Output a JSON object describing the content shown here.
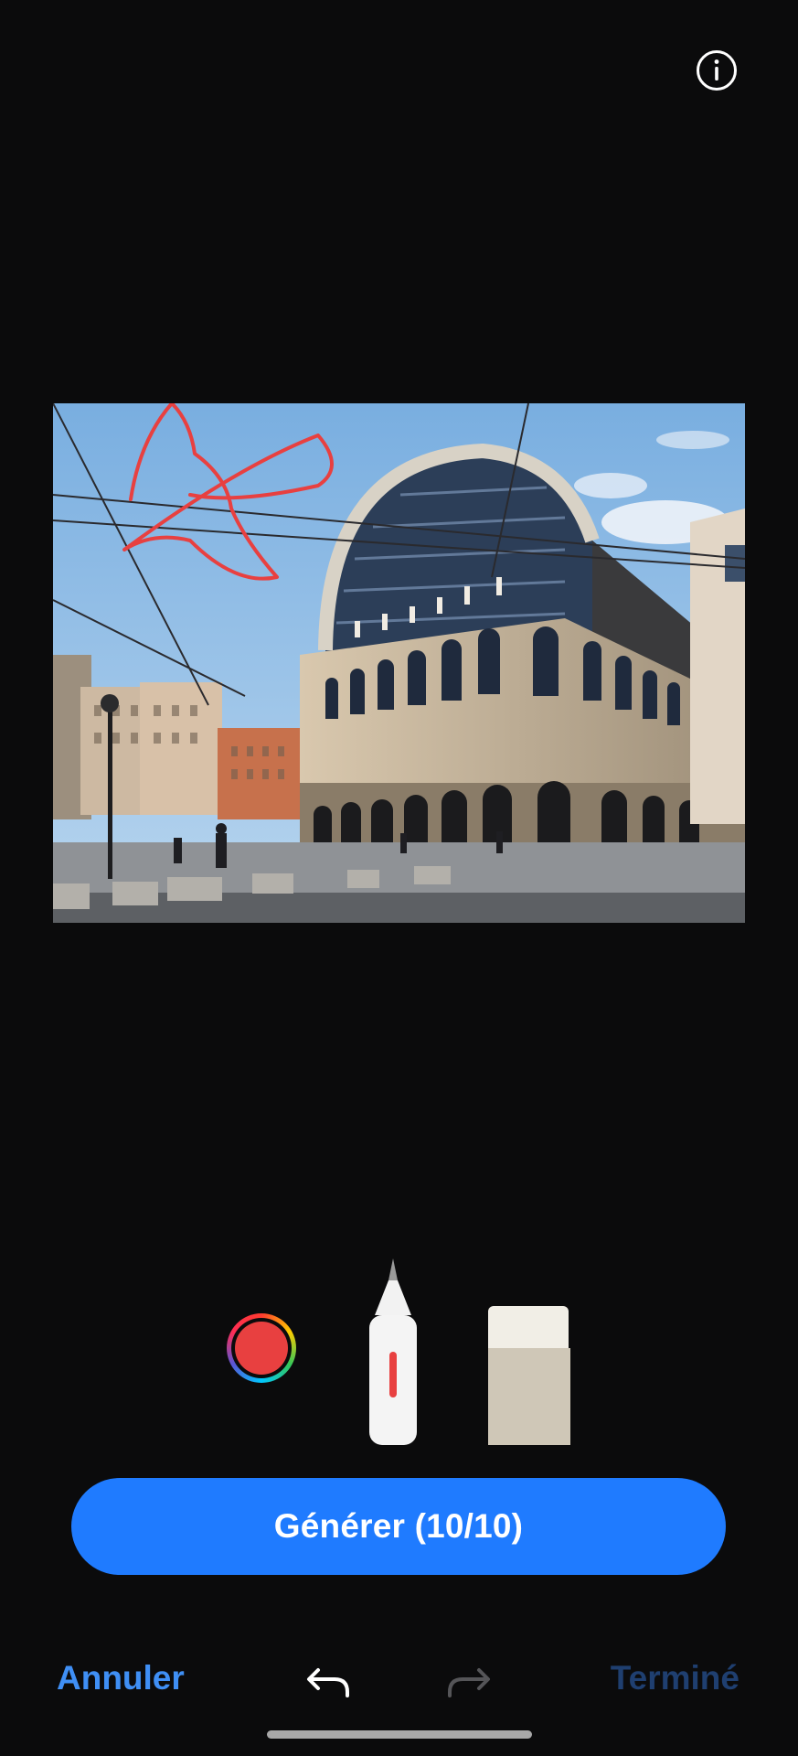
{
  "toolbar": {
    "info_icon": "info-circle-icon"
  },
  "canvas": {
    "drawing_color": "#e84040"
  },
  "tools": {
    "selected_color": "#e84040",
    "pen_icon": "pen-icon",
    "eraser_icon": "eraser-icon"
  },
  "actions": {
    "generate_label": "Générer (10/10)",
    "accent_color": "#1f7bff"
  },
  "bottom_bar": {
    "cancel_label": "Annuler",
    "done_label": "Terminé",
    "undo_icon": "undo-icon",
    "redo_icon": "redo-icon"
  }
}
